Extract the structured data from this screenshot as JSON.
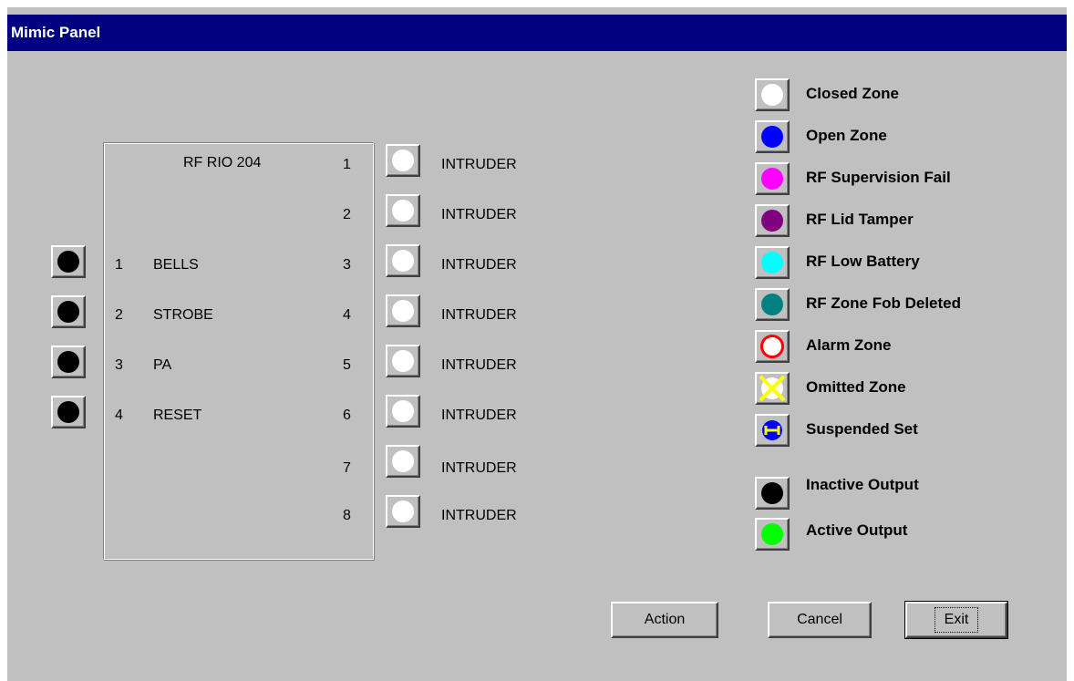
{
  "window": {
    "title": "Mimic Panel"
  },
  "rio": {
    "title": "RF RIO 204",
    "outputs": [
      {
        "num": "1",
        "label": "BELLS"
      },
      {
        "num": "2",
        "label": "STROBE"
      },
      {
        "num": "3",
        "label": "PA"
      },
      {
        "num": "4",
        "label": "RESET"
      }
    ],
    "zones": [
      {
        "num": "1",
        "label": "INTRUDER"
      },
      {
        "num": "2",
        "label": "INTRUDER"
      },
      {
        "num": "3",
        "label": "INTRUDER"
      },
      {
        "num": "4",
        "label": "INTRUDER"
      },
      {
        "num": "5",
        "label": "INTRUDER"
      },
      {
        "num": "6",
        "label": "INTRUDER"
      },
      {
        "num": "7",
        "label": "INTRUDER"
      },
      {
        "num": "8",
        "label": "INTRUDER"
      }
    ]
  },
  "legend": [
    {
      "label": "Closed Zone",
      "icon": "white-circle-icon",
      "color": "#ffffff"
    },
    {
      "label": "Open Zone",
      "icon": "blue-circle-icon",
      "color": "#0000ff"
    },
    {
      "label": "RF Supervision Fail",
      "icon": "magenta-circle-icon",
      "color": "#ff00ff"
    },
    {
      "label": "RF Lid Tamper",
      "icon": "purple-circle-icon",
      "color": "#800080"
    },
    {
      "label": "RF Low Battery",
      "icon": "cyan-circle-icon",
      "color": "#00ffff"
    },
    {
      "label": "RF Zone Fob Deleted",
      "icon": "teal-circle-icon",
      "color": "#008080"
    },
    {
      "label": "Alarm Zone",
      "icon": "red-ring-icon",
      "color": "#ff0000"
    },
    {
      "label": "Omitted Zone",
      "icon": "yellow-cross-icon",
      "color": "#ffff00"
    },
    {
      "label": "Suspended Set",
      "icon": "suspended-set-icon",
      "color": "#0000ff"
    },
    {
      "label": "Inactive Output",
      "icon": "black-circle-icon",
      "color": "#000000"
    },
    {
      "label": "Active Output",
      "icon": "green-circle-icon",
      "color": "#00ff00"
    }
  ],
  "buttons": {
    "action": "Action",
    "cancel": "Cancel",
    "exit": "Exit"
  }
}
